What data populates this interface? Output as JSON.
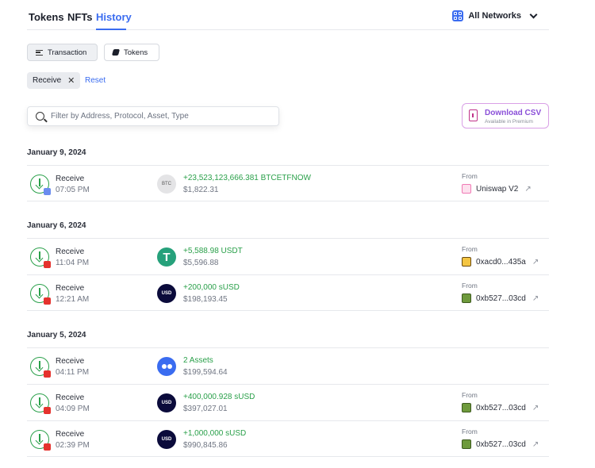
{
  "tabs": {
    "tokens": "Tokens",
    "nfts": "NFTs",
    "history": "History"
  },
  "networks": {
    "label": "All Networks"
  },
  "filters": {
    "transaction": "Transaction",
    "tokens": "Tokens"
  },
  "chip": {
    "label": "Receive",
    "close": "✕"
  },
  "reset": "Reset",
  "search": {
    "placeholder": "Filter by Address, Protocol, Asset, Type"
  },
  "csv": {
    "title": "Download CSV",
    "subtitle": "Available in Premium"
  },
  "groups": [
    {
      "date": "January 9, 2024",
      "rows": [
        {
          "type": "Receive",
          "time": "07:05 PM",
          "asset_text": "BTC",
          "amount": "+23,523,123,666.381 BTCETFNOW",
          "usd": "$1,822.31",
          "from_label": "From",
          "from": "Uniswap V2",
          "arrow": "↗"
        }
      ]
    },
    {
      "date": "January 6, 2024",
      "rows": [
        {
          "type": "Receive",
          "time": "11:04 PM",
          "asset_text": "T",
          "amount": "+5,588.98 USDT",
          "usd": "$5,596.88",
          "from_label": "From",
          "from": "0xacd0...435a",
          "arrow": "↗"
        },
        {
          "type": "Receive",
          "time": "12:21 AM",
          "asset_text": "USD",
          "amount": "+200,000 sUSD",
          "usd": "$198,193.45",
          "from_label": "From",
          "from": "0xb527...03cd",
          "arrow": "↗"
        }
      ]
    },
    {
      "date": "January 5, 2024",
      "rows": [
        {
          "type": "Receive",
          "time": "04:11 PM",
          "asset_text": "",
          "amount": "2 Assets",
          "usd": "$199,594.64"
        },
        {
          "type": "Receive",
          "time": "04:09 PM",
          "asset_text": "USD",
          "amount": "+400,000.928 sUSD",
          "usd": "$397,027.01",
          "from_label": "From",
          "from": "0xb527...03cd",
          "arrow": "↗"
        },
        {
          "type": "Receive",
          "time": "02:39 PM",
          "asset_text": "USD",
          "amount": "+1,000,000 sUSD",
          "usd": "$990,845.86",
          "from_label": "From",
          "from": "0xb527...03cd",
          "arrow": "↗"
        }
      ]
    }
  ]
}
